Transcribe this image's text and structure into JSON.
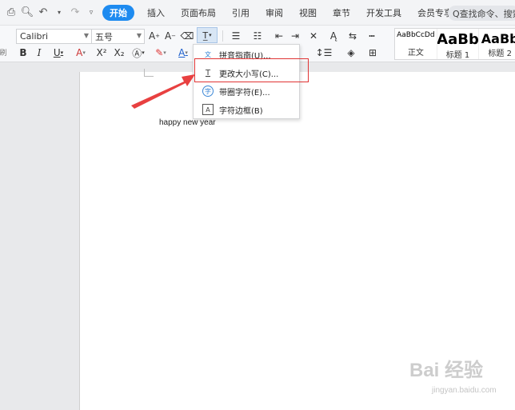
{
  "menubar": {
    "quick_icons": [
      "print-icon",
      "print-preview-icon",
      "undo-icon",
      "redo-icon",
      "customize-icon"
    ],
    "tabs": [
      {
        "label": "开始",
        "active": true
      },
      {
        "label": "插入"
      },
      {
        "label": "页面布局"
      },
      {
        "label": "引用"
      },
      {
        "label": "审阅"
      },
      {
        "label": "视图"
      },
      {
        "label": "章节"
      },
      {
        "label": "开发工具"
      },
      {
        "label": "会员专享"
      }
    ],
    "search_text": "Q查找命令、搜索"
  },
  "ribbon": {
    "font_name": "Calibri",
    "font_size": "五号",
    "paste_hint": "刷",
    "styles": [
      {
        "sample": "AaBbCcDd",
        "name": "正文"
      },
      {
        "sample": "AaBb",
        "name": "标题 1"
      },
      {
        "sample": "AaBb",
        "name": "标题 2"
      }
    ]
  },
  "document": {
    "text": "happy new year"
  },
  "dropdown": {
    "items": [
      {
        "label": "拼音指南(U)...",
        "icon": "pinyin-icon"
      },
      {
        "label": "更改大小写(C)...",
        "icon": "change-case-icon"
      },
      {
        "label": "带圈字符(E)...",
        "icon": "enclosed-char-icon"
      },
      {
        "label": "字符边框(B)",
        "icon": "char-border-icon"
      }
    ]
  },
  "colors": {
    "accent": "#1e8bf0",
    "highlight": "#e03434",
    "arrow": "#e84040"
  },
  "watermark": {
    "main": "Bai 经验",
    "sub": "jingyan.baidu.com"
  }
}
